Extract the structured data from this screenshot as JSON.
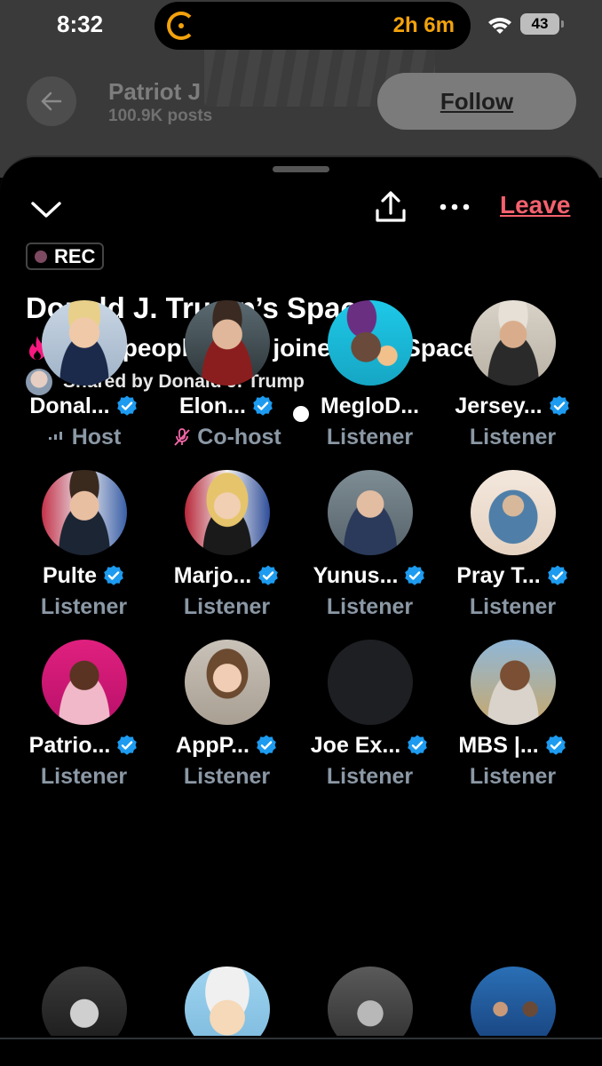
{
  "status_bar": {
    "time": "8:32",
    "timer": "2h 6m",
    "battery": "43"
  },
  "profile_header": {
    "name": "Patriot J",
    "posts": "100.9K posts",
    "follow_label": "Follow"
  },
  "space": {
    "leave_label": "Leave",
    "rec_label": "REC",
    "title": "Donald J. Trump’s Space",
    "joined_text": "697K people have joined this Space",
    "shared_by": "Shared by Donald J. Trump"
  },
  "colors": {
    "accent_red": "#f4616e",
    "verified_blue": "#1d9bf0",
    "muted_text": "#8b98a5",
    "timer_orange": "#f2a20c",
    "cohost_mute_pink": "#f266a8"
  },
  "participants": [
    {
      "name": "Donal...",
      "role": "Host",
      "role_icon": "speaking-icon",
      "verified": true
    },
    {
      "name": "Elon...",
      "role": "Co-host",
      "role_icon": "mic-muted-icon",
      "verified": true
    },
    {
      "name": "MegloD...",
      "role": "Listener",
      "verified": false
    },
    {
      "name": "Jersey...",
      "role": "Listener",
      "verified": true
    },
    {
      "name": "Pulte",
      "role": "Listener",
      "verified": true
    },
    {
      "name": "Marjo...",
      "role": "Listener",
      "verified": true
    },
    {
      "name": "Yunus...",
      "role": "Listener",
      "verified": true
    },
    {
      "name": "Pray T...",
      "role": "Listener",
      "verified": true
    },
    {
      "name": "Patrio...",
      "role": "Listener",
      "verified": true
    },
    {
      "name": "AppP...",
      "role": "Listener",
      "verified": true
    },
    {
      "name": "Joe Ex...",
      "role": "Listener",
      "verified": true
    },
    {
      "name": "MBS |...",
      "role": "Listener",
      "verified": true
    }
  ]
}
